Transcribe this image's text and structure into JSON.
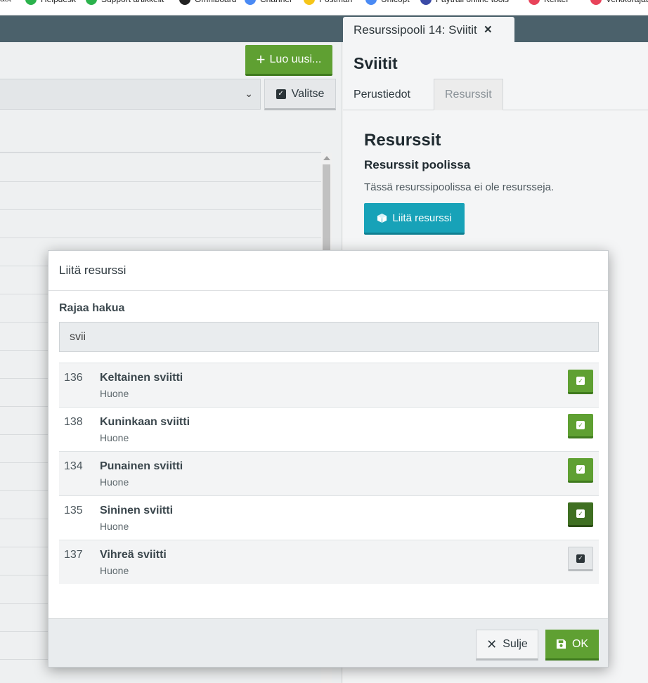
{
  "bookmarks": [
    {
      "label": "ast",
      "color": "#ffffff"
    },
    {
      "label": "Helpdesk",
      "color": "#2bb24c"
    },
    {
      "label": "Support artikkelit",
      "color": "#2bb24c"
    },
    {
      "label": "Omniboard",
      "color": "#222222"
    },
    {
      "label": "Channel",
      "color": "#4a8af4"
    },
    {
      "label": "Postman",
      "color": "#f5c518"
    },
    {
      "label": "Unicopt",
      "color": "#4a8af4"
    },
    {
      "label": "Paytrail online tools",
      "color": "#3b4aa6"
    },
    {
      "label": "Kenter",
      "color": "#e8435a"
    },
    {
      "label": "Verkkorajat",
      "color": "#e8435a"
    }
  ],
  "header": {
    "tab_title": "Resurssipooli 14: Sviitit",
    "close_icon": "×"
  },
  "left": {
    "new_button_label": "Luo uusi...",
    "select_button_label": "Valitse"
  },
  "panel": {
    "title": "Sviitit",
    "tabs": [
      "Perustiedot",
      "Resurssit"
    ],
    "active_tab": "Resurssit",
    "section_title": "Resurssit",
    "subsection_title": "Resurssit poolissa",
    "empty_text": "Tässä resurssipoolissa ei ole resursseja.",
    "attach_button_label": "Liitä resurssi"
  },
  "modal": {
    "title": "Liitä resurssi",
    "filter_label": "Rajaa hakua",
    "filter_value": "svii",
    "results": [
      {
        "id": "136",
        "name": "Keltainen sviitti",
        "type": "Huone",
        "state": "green"
      },
      {
        "id": "138",
        "name": "Kuninkaan sviitti",
        "type": "Huone",
        "state": "green"
      },
      {
        "id": "134",
        "name": "Punainen sviitti",
        "type": "Huone",
        "state": "green"
      },
      {
        "id": "135",
        "name": "Sininen sviitti",
        "type": "Huone",
        "state": "dkgreen"
      },
      {
        "id": "137",
        "name": "Vihreä sviitti",
        "type": "Huone",
        "state": "grey"
      }
    ],
    "close_button_label": "Sulje",
    "ok_button_label": "OK"
  },
  "colors": {
    "header": "#4b616b",
    "primary_green": "#5fa032",
    "info_teal": "#17a2b8"
  }
}
